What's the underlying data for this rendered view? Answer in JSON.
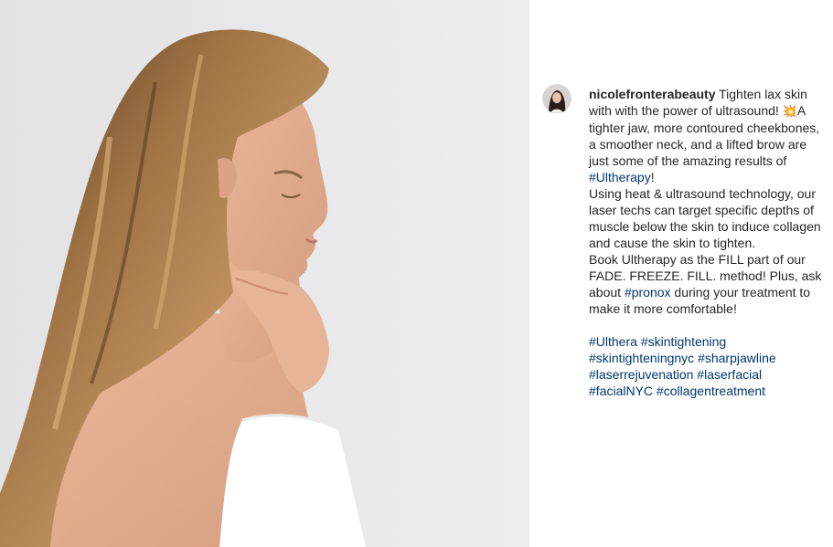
{
  "post": {
    "username": "nicolefronterabeauty",
    "caption_lines": [
      {
        "id": "l1",
        "parts": [
          {
            "t": "text",
            "v": " Tighten lax skin with with the power of ultrasound! "
          },
          {
            "t": "emoji",
            "v": "💥"
          },
          {
            "t": "text",
            "v": "A tighter jaw, more contoured cheekbones, a smoother neck, and a lifted brow are just some of the amazing results of "
          },
          {
            "t": "tag",
            "v": "#Ultherapy"
          },
          {
            "t": "text",
            "v": "!"
          }
        ]
      },
      {
        "id": "l2",
        "parts": [
          {
            "t": "text",
            "v": "Using heat & ultrasound technology, our laser techs can target specific depths of muscle below the skin to induce collagen and cause the skin to tighten."
          }
        ]
      },
      {
        "id": "l3",
        "parts": [
          {
            "t": "text",
            "v": "Book Ultherapy as the FILL part of our FADE. FREEZE. FILL. method! Plus, ask about "
          },
          {
            "t": "tag",
            "v": "#pronox"
          },
          {
            "t": "text",
            "v": " during your treatment to make it more comfortable!"
          }
        ]
      }
    ],
    "hashtags": [
      "#Ulthera",
      "#skintightening",
      "#skintighteningnyc",
      "#sharpjawline",
      "#laserrejuvenation",
      "#laserfacial",
      "#facialNYC",
      "#collagentreatment"
    ]
  },
  "colors": {
    "text": "#262626",
    "hashtag": "#00376b",
    "photo_background": "#e8e8ea"
  }
}
